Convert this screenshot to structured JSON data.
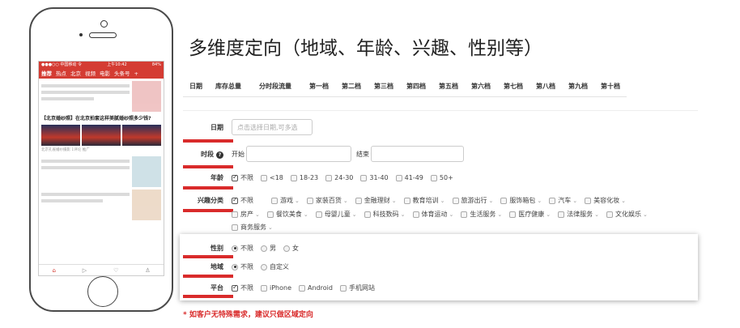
{
  "title": "多维度定向（地域、年龄、兴趣、性别等）",
  "columns": [
    "日期",
    "库存总量",
    "分时段流量",
    "第一档",
    "第二档",
    "第三档",
    "第四档",
    "第五档",
    "第六档",
    "第七档",
    "第八档",
    "第九档",
    "第十档"
  ],
  "form": {
    "date": {
      "label": "日期",
      "placeholder": "点击选择日期,可多选"
    },
    "period": {
      "label": "时段",
      "start_label": "开始",
      "end_label": "结束"
    },
    "age": {
      "label": "年龄",
      "options": [
        {
          "text": "不限",
          "checked": true
        },
        {
          "text": "<18"
        },
        {
          "text": "18-23"
        },
        {
          "text": "24-30"
        },
        {
          "text": "31-40"
        },
        {
          "text": "41-49"
        },
        {
          "text": "50+"
        }
      ]
    },
    "interest": {
      "label": "兴趣分类",
      "row1": [
        "不限",
        "游戏",
        "家装百货",
        "金融理财",
        "教育培训",
        "旅游出行",
        "服饰箱包",
        "汽车",
        "美容化妆"
      ],
      "row2": [
        "房产",
        "餐饮美食",
        "母婴儿童",
        "科技数码",
        "体育运动",
        "生活服务",
        "医疗健康",
        "法律服务",
        "文化娱乐"
      ],
      "row3": [
        "商务服务"
      ]
    },
    "gender": {
      "label": "性别",
      "options": [
        "不限",
        "男",
        "女"
      ]
    },
    "region": {
      "label": "地域",
      "options": [
        "不限",
        "自定义"
      ]
    },
    "platform": {
      "label": "平台",
      "options": [
        "不限",
        "iPhone",
        "Android",
        "手机网站"
      ]
    }
  },
  "note": "* 如客户无特殊需求，建议只做区域定向",
  "phone": {
    "status_left": "●●●○○ 中国移动 令",
    "status_time": "上午10:42",
    "status_right": "84%",
    "nav": [
      "推荐",
      "热点",
      "北京",
      "视频",
      "电影",
      "头条号",
      "+"
    ],
    "headline": "【北京婚纱照】在北京拍套这样美腻婚纱照多少钱?",
    "source": "北京孔雀婚纱摄影 1评论 推广",
    "tabs": [
      "⌂",
      "▷",
      "♡",
      "♙"
    ]
  },
  "colors": {
    "accent": "#d92b2b",
    "phone_bar": "#d43c33"
  }
}
